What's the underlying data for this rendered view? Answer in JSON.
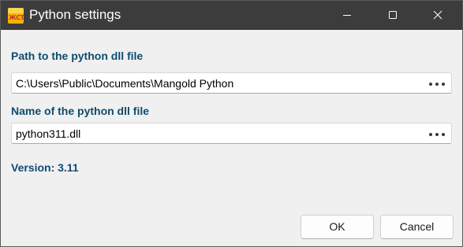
{
  "window": {
    "title": "Python settings",
    "icon": "app-logo-icon",
    "icon_text": "ЖСТ",
    "controls": [
      "minimize-icon",
      "maximize-icon",
      "close-icon"
    ],
    "colors": {
      "titlebar": "#3c3c3c",
      "label": "#0e4c6e",
      "background": "#f0f0f0"
    }
  },
  "path_field": {
    "label": "Path to the python dll file",
    "value": "C:\\Users\\Public\\Documents\\Mangold Python",
    "browse_icon": "ellipsis-icon"
  },
  "name_field": {
    "label": "Name of the python dll file",
    "value": "python311.dll",
    "browse_icon": "ellipsis-icon"
  },
  "version_text": "Version: 3.11",
  "buttons": {
    "ok": "OK",
    "cancel": "Cancel"
  }
}
